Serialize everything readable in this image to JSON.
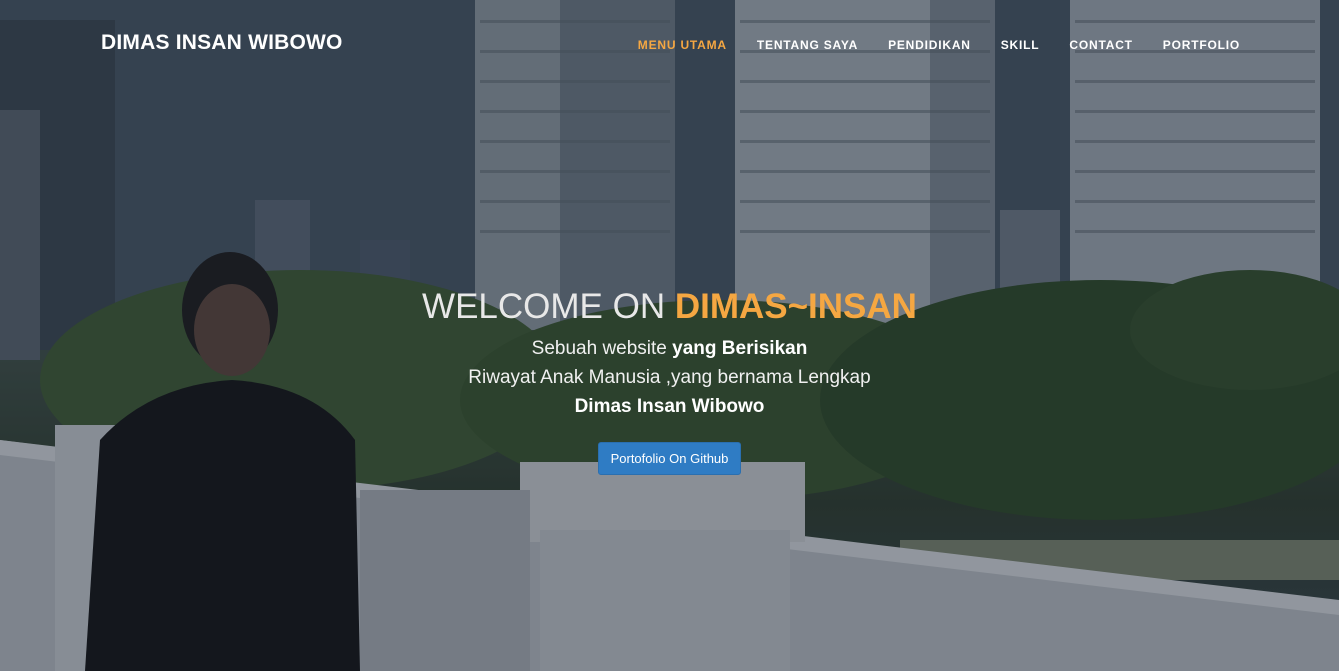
{
  "header": {
    "brand": "DIMAS INSAN WIBOWO",
    "nav": [
      {
        "label": "MENU UTAMA",
        "active": true
      },
      {
        "label": "TENTANG SAYA",
        "active": false
      },
      {
        "label": "PENDIDIKAN",
        "active": false
      },
      {
        "label": "SKILL",
        "active": false
      },
      {
        "label": "CONTACT",
        "active": false
      },
      {
        "label": "PORTFOLIO",
        "active": false
      }
    ]
  },
  "intro": {
    "heading_prefix": "WELCOME ON ",
    "heading_accent": "DIMAS~INSAN",
    "line1_plain": "Sebuah website ",
    "line1_bold": "yang Berisikan",
    "line2": "Riwayat Anak Manusia ,yang bernama Lengkap",
    "line3_bold": "Dimas Insan Wibowo",
    "button_label": "Portofolio On Github"
  },
  "colors": {
    "accent": "#f5a742",
    "button": "#2f7cc4"
  }
}
